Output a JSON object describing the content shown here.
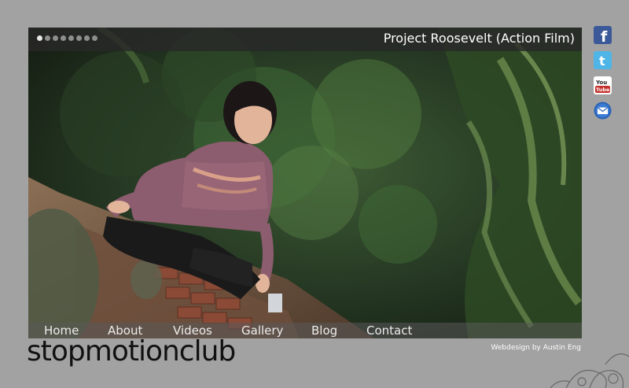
{
  "slideshow": {
    "title": "Project Roosevelt (Action Film)",
    "dots": [
      "",
      "",
      "",
      "",
      "",
      "",
      "",
      ""
    ],
    "active_dot": 0
  },
  "nav": {
    "items": [
      {
        "label": "Home"
      },
      {
        "label": "About"
      },
      {
        "label": "Videos"
      },
      {
        "label": "Gallery"
      },
      {
        "label": "Blog"
      },
      {
        "label": "Contact"
      }
    ]
  },
  "brand": "stopmotionclub",
  "credit": "Webdesign by Austin Eng",
  "social": {
    "facebook": {
      "icon": "facebook-icon",
      "color": "#3b5998",
      "glyph": "f"
    },
    "twitter": {
      "icon": "twitter-icon",
      "color": "#4fb4e6",
      "glyph": "t"
    },
    "youtube": {
      "icon": "youtube-icon",
      "color": "#c4302b",
      "glyph": "You Tube"
    },
    "email": {
      "icon": "email-icon",
      "color": "#2a62b5"
    }
  }
}
